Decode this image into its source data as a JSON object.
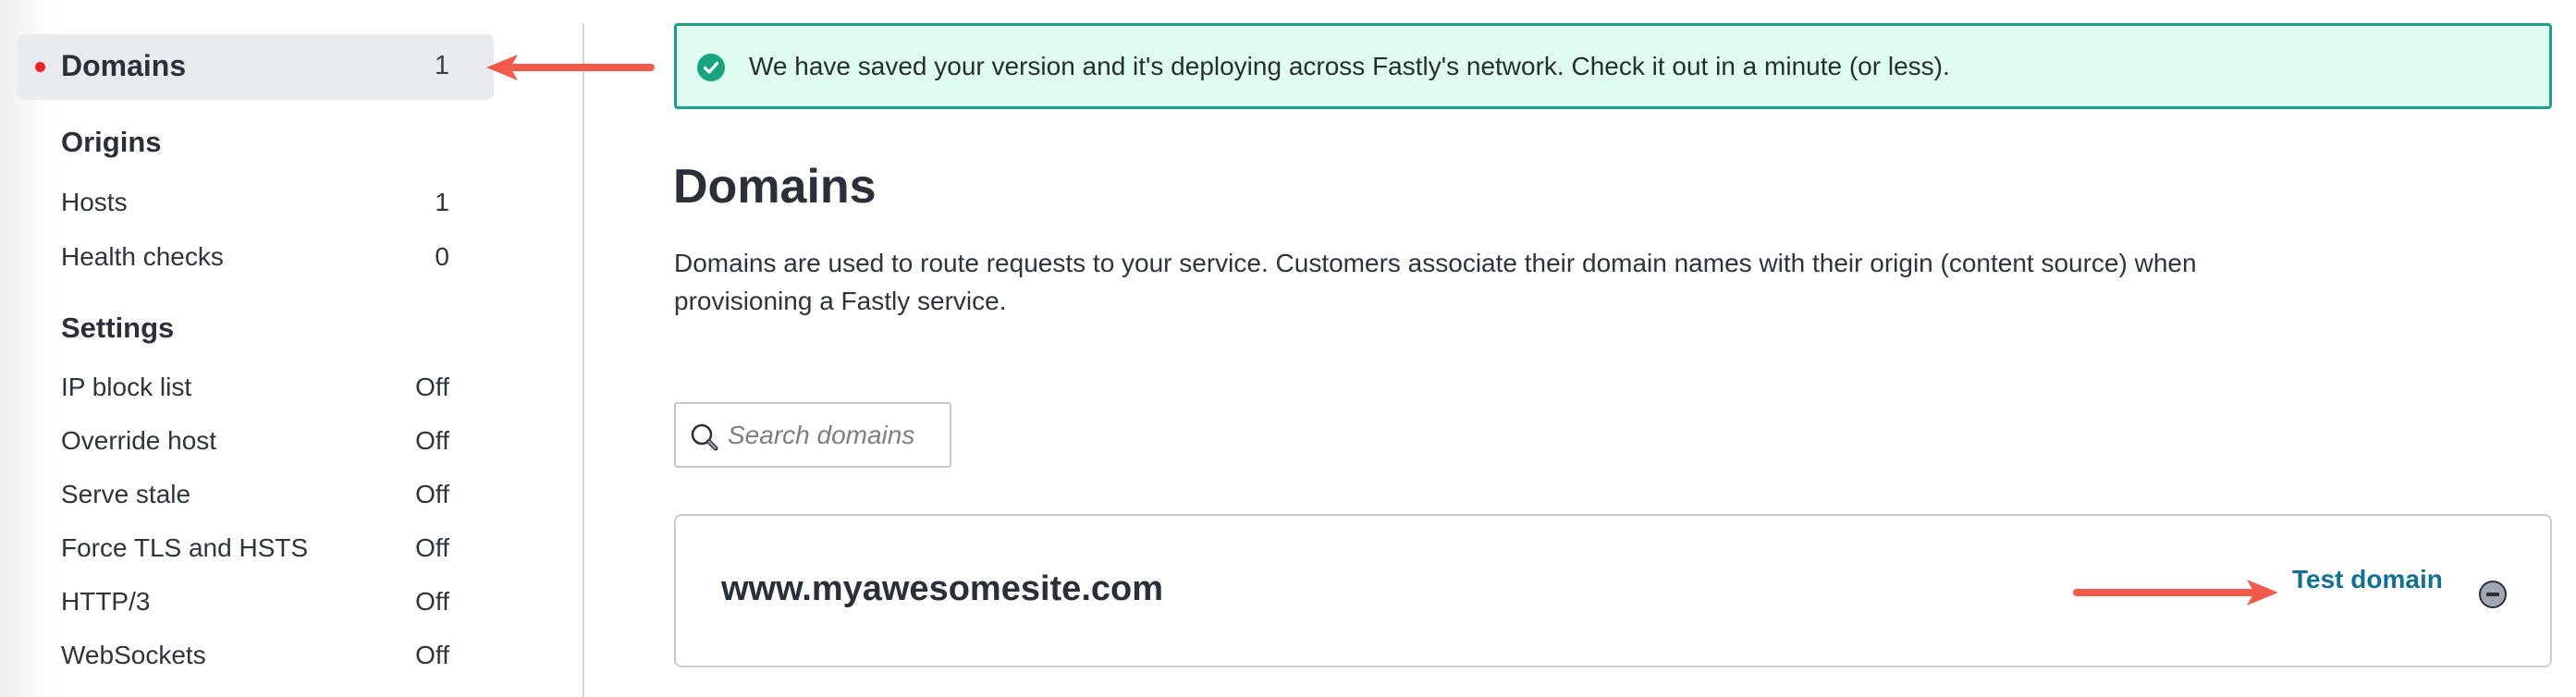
{
  "sidebar": {
    "active_item": {
      "label": "Domains",
      "count": "1"
    },
    "sections": [
      {
        "heading": "Origins",
        "items": [
          {
            "label": "Hosts",
            "value": "1"
          },
          {
            "label": "Health checks",
            "value": "0"
          }
        ]
      },
      {
        "heading": "Settings",
        "items": [
          {
            "label": "IP block list",
            "value": "Off"
          },
          {
            "label": "Override host",
            "value": "Off"
          },
          {
            "label": "Serve stale",
            "value": "Off"
          },
          {
            "label": "Force TLS and HSTS",
            "value": "Off"
          },
          {
            "label": "HTTP/3",
            "value": "Off"
          },
          {
            "label": "WebSockets",
            "value": "Off"
          }
        ]
      }
    ]
  },
  "banner": {
    "icon": "check-circle-icon",
    "message": "We have saved your version and it's deploying across Fastly's network. Check it out in a minute (or less)."
  },
  "main": {
    "title": "Domains",
    "description": "Domains are used to route requests to your service. Customers associate their domain names with their origin (content source) when provisioning a Fastly service.",
    "search": {
      "placeholder": "Search domains",
      "value": ""
    },
    "domains": [
      {
        "name": "www.myawesomesite.com",
        "test_label": "Test domain",
        "remove_icon": "remove-circle-icon"
      }
    ]
  },
  "colors": {
    "success_bg": "#e0fbf0",
    "success_border": "#1f9e88",
    "link": "#0f7192",
    "active_dot": "#f0202a",
    "annotation_arrow": "#f25a4c"
  }
}
